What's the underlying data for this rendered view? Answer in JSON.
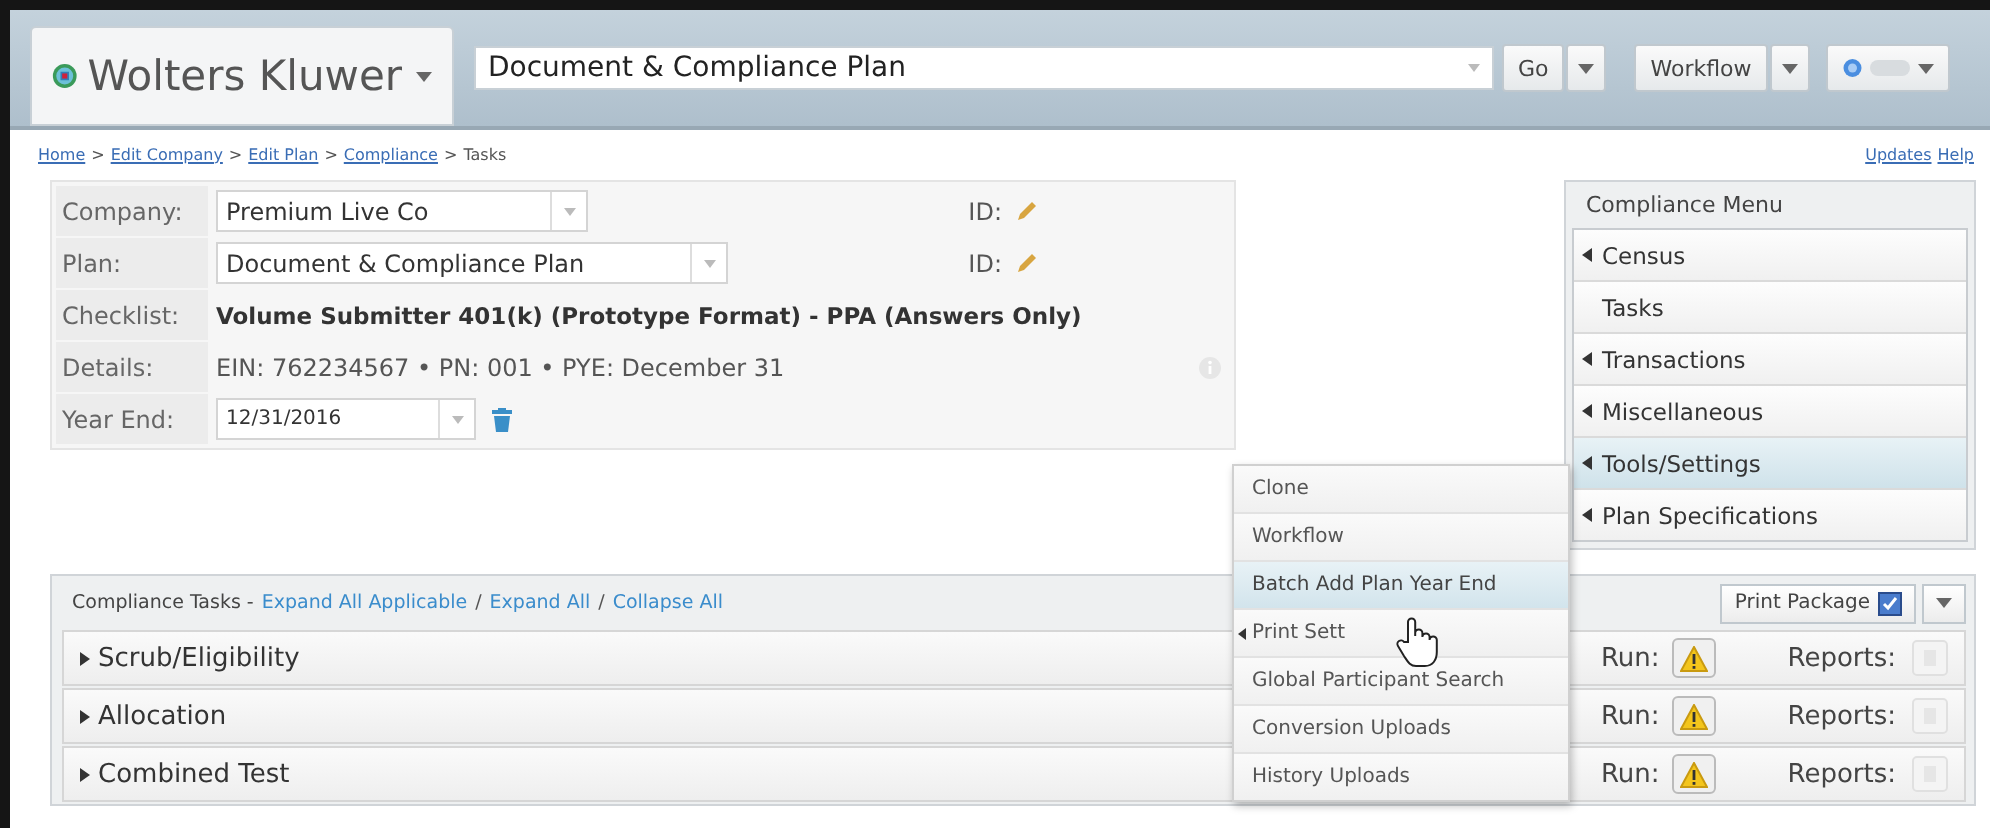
{
  "brand": {
    "name": "Wolters Kluwer"
  },
  "search": {
    "value": "Document & Compliance Plan"
  },
  "header_buttons": {
    "go": "Go",
    "workflow": "Workflow"
  },
  "breadcrumb": {
    "separator": ">",
    "items": [
      {
        "label": "Home",
        "link": true
      },
      {
        "label": "Edit Company",
        "link": true
      },
      {
        "label": "Edit Plan",
        "link": true
      },
      {
        "label": "Compliance",
        "link": true
      },
      {
        "label": "Tasks",
        "link": false
      }
    ]
  },
  "top_links": [
    "Updates",
    "Help"
  ],
  "form": {
    "rows": [
      {
        "label": "Company:",
        "kind": "select",
        "value": "Premium Live Co",
        "id_label": "ID:"
      },
      {
        "label": "Plan:",
        "kind": "select",
        "value": "Document & Compliance Plan",
        "id_label": "ID:"
      },
      {
        "label": "Checklist:",
        "kind": "bold",
        "value": "Volume Submitter 401(k) (Prototype Format) - PPA (Answers Only)"
      },
      {
        "label": "Details:",
        "kind": "text",
        "value": "EIN: 762234567 • PN: 001 • PYE: December 31"
      },
      {
        "label": "Year End:",
        "kind": "date",
        "value": "12/31/2016"
      }
    ]
  },
  "compliance_menu": {
    "title": "Compliance Menu",
    "items": [
      {
        "label": "Census",
        "has_submenu": true,
        "selected": false
      },
      {
        "label": "Tasks",
        "has_submenu": false,
        "selected": false
      },
      {
        "label": "Transactions",
        "has_submenu": true,
        "selected": false
      },
      {
        "label": "Miscellaneous",
        "has_submenu": true,
        "selected": false
      },
      {
        "label": "Tools/Settings",
        "has_submenu": true,
        "selected": true
      },
      {
        "label": "Plan Specifications",
        "has_submenu": true,
        "selected": false
      }
    ]
  },
  "popup_menu": {
    "items": [
      {
        "label": "Clone",
        "has_submenu": false,
        "selected": false
      },
      {
        "label": "Workflow",
        "has_submenu": false,
        "selected": false
      },
      {
        "label": "Batch Add Plan Year End",
        "has_submenu": false,
        "selected": true
      },
      {
        "label": "Print Sett",
        "has_submenu": true,
        "selected": false
      },
      {
        "label": "Global Participant Search",
        "has_submenu": false,
        "selected": false
      },
      {
        "label": "Conversion Uploads",
        "has_submenu": false,
        "selected": false
      },
      {
        "label": "History Uploads",
        "has_submenu": false,
        "selected": false
      }
    ]
  },
  "tasks": {
    "title": "Compliance Tasks -",
    "separator": "/",
    "links": [
      "Expand All Applicable",
      "Expand All",
      "Collapse All"
    ],
    "print_button": "Print Package",
    "rows": [
      {
        "name": "Scrub/Eligibility",
        "run_label": "Run:",
        "reports_label": "Reports:"
      },
      {
        "name": "Allocation",
        "run_label": "Run:",
        "reports_label": "Reports:"
      },
      {
        "name": "Combined Test",
        "run_label": "Run:",
        "reports_label": "Reports:"
      }
    ]
  }
}
